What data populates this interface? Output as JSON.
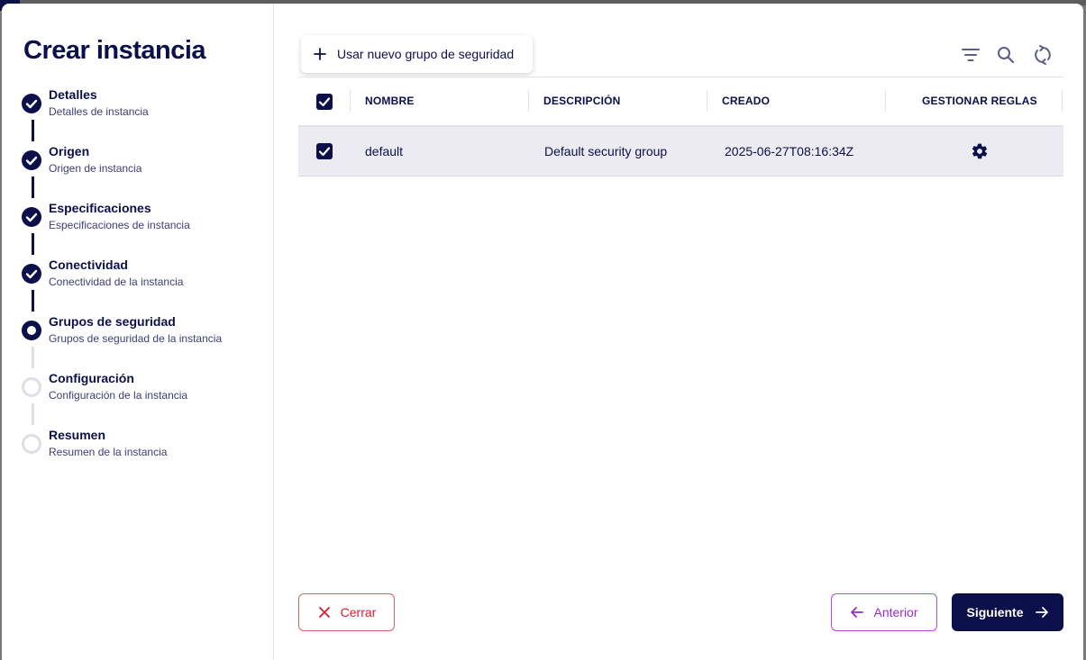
{
  "title": "Crear instancia",
  "steps": [
    {
      "title": "Detalles",
      "subtitle": "Detalles de instancia",
      "status": "done"
    },
    {
      "title": "Origen",
      "subtitle": "Origen de instancia",
      "status": "done"
    },
    {
      "title": "Especificaciones",
      "subtitle": "Especificaciones de instancia",
      "status": "done"
    },
    {
      "title": "Conectividad",
      "subtitle": "Conectividad de la instancia",
      "status": "done"
    },
    {
      "title": "Grupos de seguridad",
      "subtitle": "Grupos de seguridad de la instancia",
      "status": "current"
    },
    {
      "title": "Configuración",
      "subtitle": "Configuración de la instancia",
      "status": "todo"
    },
    {
      "title": "Resumen",
      "subtitle": "Resumen de la instancia",
      "status": "todo"
    }
  ],
  "toolbar": {
    "add_label": "Usar nuevo grupo de seguridad",
    "icons": [
      "filter-icon",
      "search-icon",
      "refresh-icon"
    ]
  },
  "table": {
    "headers": {
      "name": "NOMBRE",
      "description": "DESCRIPCIÓN",
      "created": "CREADO",
      "manage_rules": "GESTIONAR REGLAS"
    },
    "select_all_checked": true,
    "rows": [
      {
        "checked": true,
        "name": "default",
        "description": "Default security group",
        "created": "2025-06-27T08:16:34Z",
        "manage_icon": "gear-icon"
      }
    ]
  },
  "footer": {
    "close_label": "Cerrar",
    "prev_label": "Anterior",
    "next_label": "Siguiente"
  },
  "colors": {
    "primary": "#0b0f4a",
    "danger": "#d3232e",
    "secondary": "#9b2cc9",
    "row_selected_bg": "#ebebf1"
  }
}
